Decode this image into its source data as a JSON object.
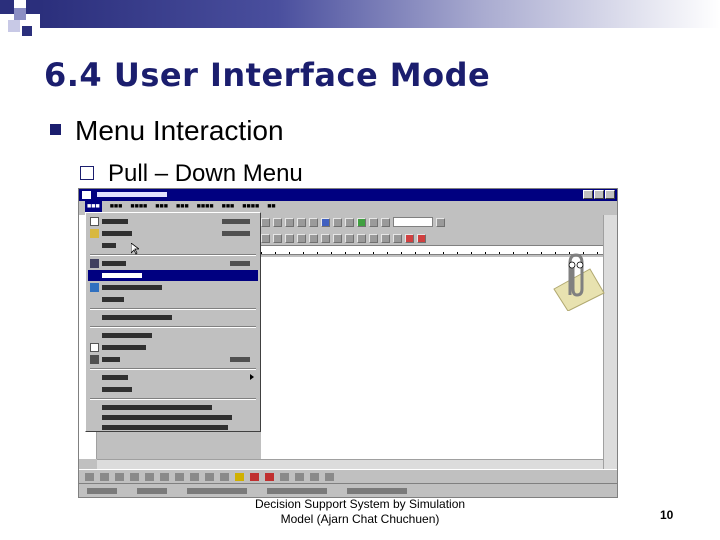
{
  "slide": {
    "title": "6.4 User Interface Mode",
    "bullet_level1": "Menu Interaction",
    "bullet_level2": "Pull – Down Menu",
    "footer_line1": "Decision Support System by Simulation",
    "footer_line2": "Model (Ajarn Chat Chuchuen)",
    "page_number": "10"
  },
  "colors": {
    "title": "#1b1e6e",
    "accent": "#2b2f7c",
    "window_titlebar": "#000080",
    "menu_highlight": "#000080"
  },
  "screenshot": {
    "app": "Microsoft Word",
    "icons": [
      "word-app-icon",
      "assistant-paperclip-icon",
      "mouse-cursor-icon"
    ],
    "menu_open": "File"
  }
}
